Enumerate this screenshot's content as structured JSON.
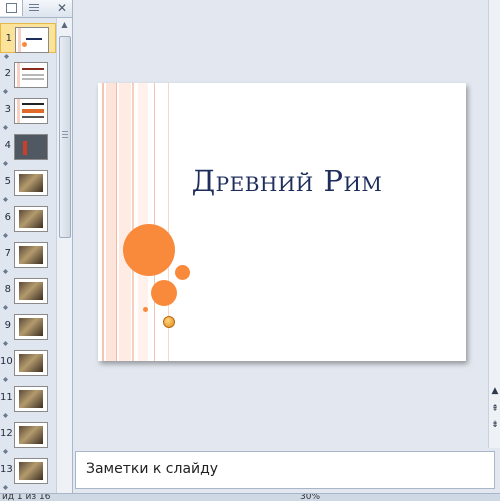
{
  "slide_pane": {
    "thumbnails": [
      {
        "number": "1",
        "kind": "title",
        "selected": true
      },
      {
        "number": "2",
        "kind": "lines"
      },
      {
        "number": "3",
        "kind": "lines-orange"
      },
      {
        "number": "4",
        "kind": "dark"
      },
      {
        "number": "5",
        "kind": "photo"
      },
      {
        "number": "6",
        "kind": "photo"
      },
      {
        "number": "7",
        "kind": "photo"
      },
      {
        "number": "8",
        "kind": "photo"
      },
      {
        "number": "9",
        "kind": "photo"
      },
      {
        "number": "10",
        "kind": "photo"
      },
      {
        "number": "11",
        "kind": "photo"
      },
      {
        "number": "12",
        "kind": "photo"
      },
      {
        "number": "13",
        "kind": "photo"
      }
    ]
  },
  "slide": {
    "title": "Древний Рим",
    "accent_color": "#f98a3c",
    "title_color": "#1e2d5c"
  },
  "notes": {
    "placeholder": "Заметки к слайду"
  },
  "status_bar": {
    "slide_counter": "йд 1 из 16",
    "zoom": "30%"
  }
}
